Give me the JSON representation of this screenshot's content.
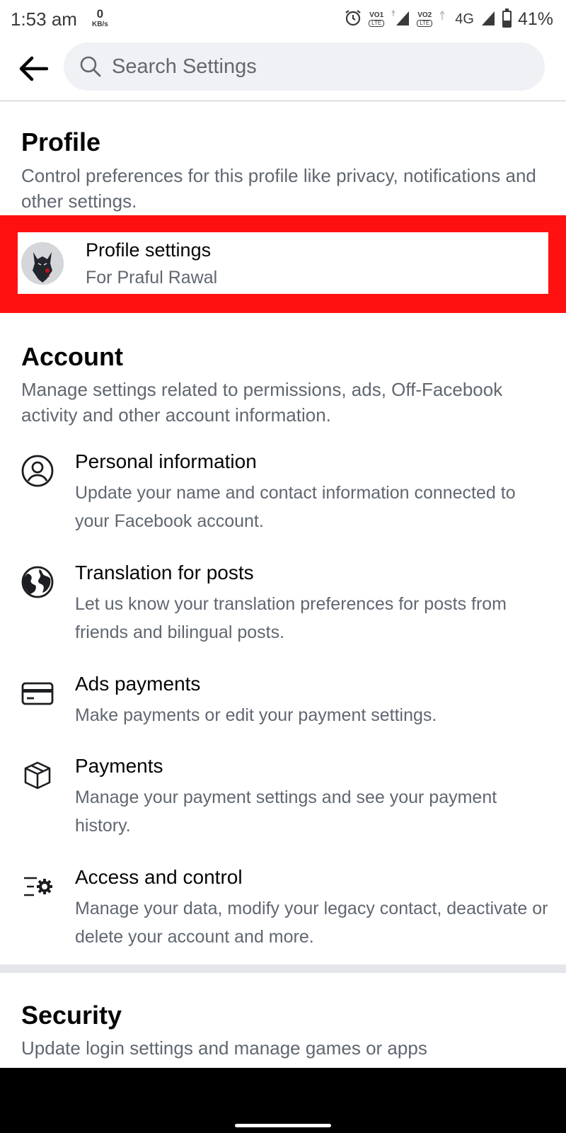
{
  "status_bar": {
    "time": "1:53 am",
    "net_speed_value": "0",
    "net_speed_unit": "KB/s",
    "sim1_label": "VO1",
    "sim1_sub": "LTE",
    "sim2_label": "VO2",
    "sim2_sub": "LTE",
    "network_type": "4G",
    "battery_percent": "41%",
    "battery_level": 0.41
  },
  "topbar": {
    "search_placeholder": "Search Settings"
  },
  "profile_section": {
    "title": "Profile",
    "description": "Control preferences for this profile like privacy, notifications and other settings.",
    "row_title": "Profile settings",
    "row_subtitle": "For Praful Rawal",
    "highlight_color": "#ff1111"
  },
  "account_section": {
    "title": "Account",
    "description": "Manage settings related to permissions, ads, Off-Facebook activity and other account information.",
    "items": [
      {
        "title": "Personal information",
        "desc": "Update your name and contact information connected to your Facebook account.",
        "icon": "person-circle-icon"
      },
      {
        "title": "Translation for posts",
        "desc": "Let us know your translation preferences for posts from friends and bilingual posts.",
        "icon": "globe-icon"
      },
      {
        "title": "Ads payments",
        "desc": "Make payments or edit your payment settings.",
        "icon": "credit-card-icon"
      },
      {
        "title": "Payments",
        "desc": "Manage your payment settings and see your payment history.",
        "icon": "box-icon"
      },
      {
        "title": "Access and control",
        "desc": "Manage your data, modify your legacy contact, deactivate or delete your account and more.",
        "icon": "list-gear-icon"
      }
    ]
  },
  "security_section": {
    "title": "Security",
    "description": "Update login settings and manage games or apps"
  }
}
